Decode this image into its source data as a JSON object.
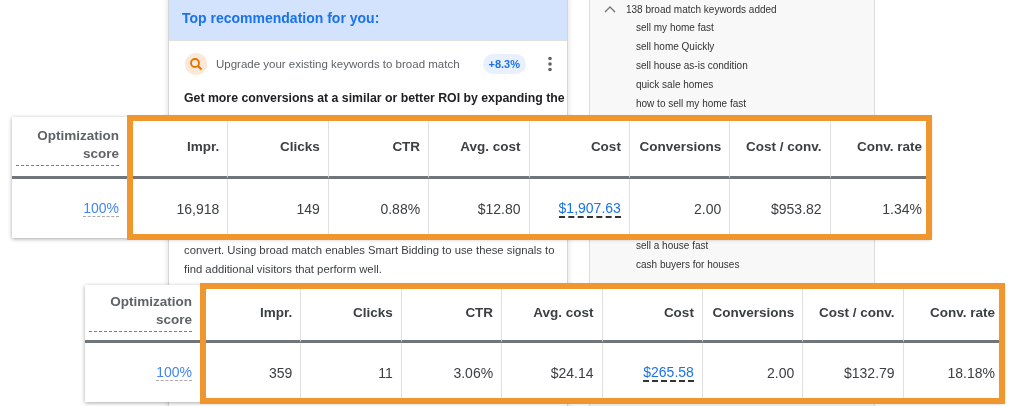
{
  "recommendation_card": {
    "header": "Top recommendation for you:",
    "recommendation": {
      "title": "Upgrade your existing keywords to broad match",
      "badge": "+8.3%"
    },
    "headline": "Get more conversions at a similar or better ROI by expanding the",
    "body": "convert. Using broad match enables Smart Bidding to use these signals to find additional visitors that perform well."
  },
  "keyword_panel": {
    "label": "138 broad match keywords added",
    "expanded": true,
    "children": [
      {
        "label": "sell my home fast"
      },
      {
        "label": "sell home Quickly"
      },
      {
        "label": "sell house as-is condition"
      },
      {
        "label": "quick sale homes"
      },
      {
        "label": "how to sell my home fast"
      },
      {
        "label": "sell a house fast"
      },
      {
        "label": "cash buyers for houses"
      }
    ]
  },
  "tables": [
    {
      "columns": [
        "Optimization score",
        "Impr.",
        "Clicks",
        "CTR",
        "Avg. cost",
        "Cost",
        "Conversions",
        "Cost / conv.",
        "Conv. rate"
      ],
      "row": [
        "100%",
        "16,918",
        "149",
        "0.88%",
        "$12.80",
        "$1,907.63",
        "2.00",
        "$953.82",
        "1.34%"
      ]
    },
    {
      "columns": [
        "Optimization score",
        "Impr.",
        "Clicks",
        "CTR",
        "Avg. cost",
        "Cost",
        "Conversions",
        "Cost / conv.",
        "Conv. rate"
      ],
      "row": [
        "100%",
        "359",
        "11",
        "3.06%",
        "$24.14",
        "$265.58",
        "2.00",
        "$132.79",
        "18.18%"
      ]
    }
  ]
}
